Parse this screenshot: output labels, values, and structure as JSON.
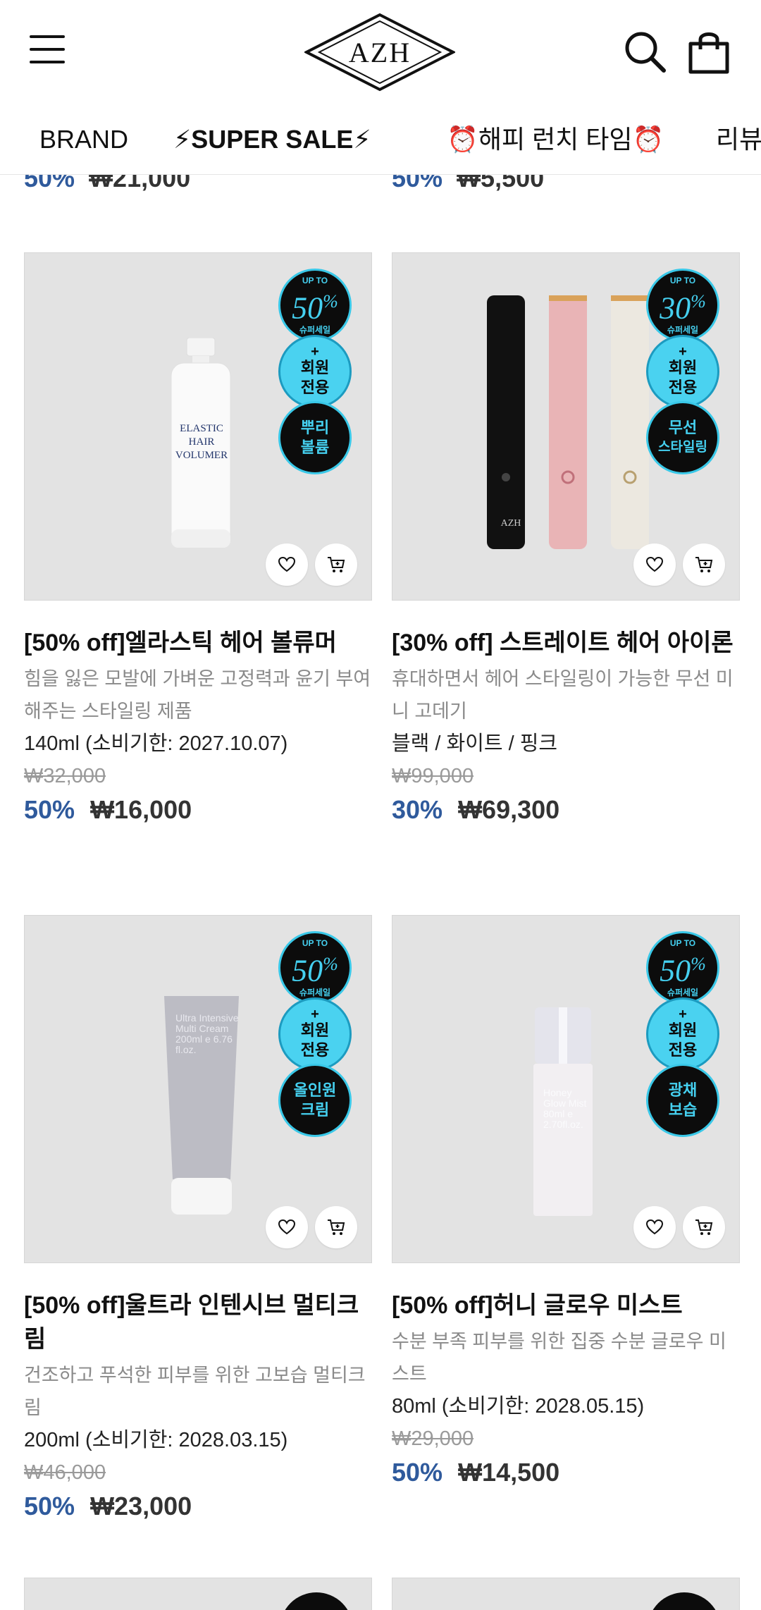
{
  "header": {
    "logo_text": "AZH"
  },
  "tabs": [
    {
      "label": "BRAND"
    },
    {
      "label": "⚡SUPER SALE⚡"
    },
    {
      "label": "⏰해피 런치 타임⏰"
    },
    {
      "label": "리뷰"
    }
  ],
  "peek_prices": [
    {
      "discount": "50%",
      "price": "₩21,000"
    },
    {
      "discount": "50%",
      "price": "₩5,500"
    }
  ],
  "products": [
    {
      "badge_top_small": "UP TO",
      "badge_top_value": "50",
      "badge_top_unit": "%",
      "badge_top_sub": "슈퍼세일",
      "badge_mid_plus": "+",
      "badge_mid_line1": "회원",
      "badge_mid_line2": "전용",
      "badge_bottom_line1": "뿌리",
      "badge_bottom_line2": "볼륨",
      "image_label": "ELASTIC HAIR VOLUMER",
      "title": "[50% off]엘라스틱 헤어 볼류머",
      "desc": "힘을 잃은 모발에 가벼운 고정력과 윤기 부여해주는 스타일링 제품",
      "option": "140ml (소비기한: 2027.10.07)",
      "original_price": "₩32,000",
      "discount": "50%",
      "price": "₩16,000"
    },
    {
      "badge_top_small": "UP TO",
      "badge_top_value": "30",
      "badge_top_unit": "%",
      "badge_top_sub": "슈퍼세일",
      "badge_mid_plus": "+",
      "badge_mid_line1": "회원",
      "badge_mid_line2": "전용",
      "badge_bottom_line1": "무선",
      "badge_bottom_line2": "스타일링",
      "image_label": "AZH",
      "title": "[30% off] 스트레이트 헤어 아이론",
      "desc": "휴대하면서 헤어 스타일링이 가능한 무선 미니 고데기",
      "option": "블랙 / 화이트 / 핑크",
      "original_price": "₩99,000",
      "discount": "30%",
      "price": "₩69,300"
    },
    {
      "badge_top_small": "UP TO",
      "badge_top_value": "50",
      "badge_top_unit": "%",
      "badge_top_sub": "슈퍼세일",
      "badge_mid_plus": "+",
      "badge_mid_line1": "회원",
      "badge_mid_line2": "전용",
      "badge_bottom_line1": "올인원",
      "badge_bottom_line2": "크림",
      "image_label": "Ultra Intensive Multi Cream 200ml e 6.76 fl.oz.",
      "title": "[50% off]울트라 인텐시브 멀티크림",
      "desc": "건조하고 푸석한 피부를 위한 고보습 멀티크림",
      "option": "200ml (소비기한: 2028.03.15)",
      "original_price": "₩46,000",
      "discount": "50%",
      "price": "₩23,000"
    },
    {
      "badge_top_small": "UP TO",
      "badge_top_value": "50",
      "badge_top_unit": "%",
      "badge_top_sub": "슈퍼세일",
      "badge_mid_plus": "+",
      "badge_mid_line1": "회원",
      "badge_mid_line2": "전용",
      "badge_bottom_line1": "광채",
      "badge_bottom_line2": "보습",
      "image_label": "Honey Glow Mist 80ml e 2.70fl.oz.",
      "title": "[50% off]허니 글로우 미스트",
      "desc": "수분 부족 피부를 위한 집중 수분 글로우 미스트",
      "option": "80ml (소비기한: 2028.05.15)",
      "original_price": "₩29,000",
      "discount": "50%",
      "price": "₩14,500"
    }
  ]
}
